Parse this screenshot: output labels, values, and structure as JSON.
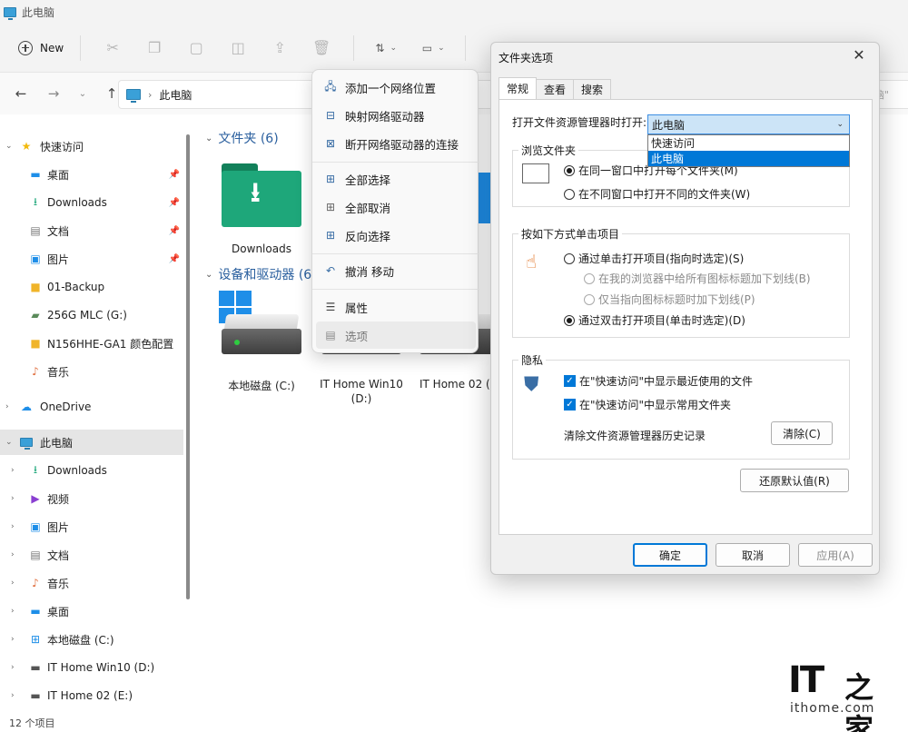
{
  "window": {
    "title": "此电脑"
  },
  "commandbar": {
    "new_label": "New"
  },
  "address": {
    "path": "此电脑",
    "right_fragment": "脑\""
  },
  "sidebar": {
    "quick_access": "快速访问",
    "quick_items": [
      {
        "label": "桌面",
        "pinned": true
      },
      {
        "label": "Downloads",
        "pinned": true
      },
      {
        "label": "文档",
        "pinned": true
      },
      {
        "label": "图片",
        "pinned": true
      },
      {
        "label": "01-Backup"
      },
      {
        "label": "256G MLC (G:)"
      },
      {
        "label": "N156HHE-GA1 颜色配置"
      },
      {
        "label": "音乐"
      }
    ],
    "onedrive": "OneDrive",
    "this_pc": "此电脑",
    "pc_items": [
      "Downloads",
      "视频",
      "图片",
      "文档",
      "音乐",
      "桌面",
      "本地磁盘 (C:)",
      "IT Home Win10 (D:)",
      "IT Home 02 (E:)"
    ]
  },
  "status": {
    "item_count": "12 个项目"
  },
  "content": {
    "folders_header": "文件夹 (6)",
    "downloads_tile": "Downloads",
    "devices_header": "设备和驱动器 (6",
    "drives": [
      "本地磁盘 (C:)",
      "IT Home Win10",
      "(D:)",
      "IT Home 02 (E"
    ]
  },
  "context_menu": {
    "items": [
      {
        "label": "添加一个网络位置",
        "icon": "network-location-icon"
      },
      {
        "label": "映射网络驱动器",
        "icon": "map-drive-icon"
      },
      {
        "label": "断开网络驱动器的连接",
        "icon": "disconnect-drive-icon"
      },
      {
        "label": "全部选择",
        "icon": "select-all-icon"
      },
      {
        "label": "全部取消",
        "icon": "select-none-icon"
      },
      {
        "label": "反向选择",
        "icon": "invert-selection-icon"
      },
      {
        "label": "撤消 移动",
        "icon": "undo-icon"
      },
      {
        "label": "属性",
        "icon": "properties-icon"
      },
      {
        "label": "选项",
        "icon": "options-icon"
      }
    ]
  },
  "dialog": {
    "title": "文件夹选项",
    "tabs": [
      "常规",
      "查看",
      "搜索"
    ],
    "open_label": "打开文件资源管理器时打开:",
    "open_value": "此电脑",
    "open_options": [
      "快速访问",
      "此电脑"
    ],
    "browse_legend": "浏览文件夹",
    "browse_same": "在同一窗口中打开每个文件夹(M)",
    "browse_diff": "在不同窗口中打开不同的文件夹(W)",
    "click_legend": "按如下方式单击项目",
    "single_click": "通过单击打开项目(指向时选定)(S)",
    "underline_all": "在我的浏览器中给所有图标标题加下划线(B)",
    "underline_hover": "仅当指向图标标题时加下划线(P)",
    "double_click": "通过双击打开项目(单击时选定)(D)",
    "privacy_legend": "隐私",
    "show_recent": "在\"快速访问\"中显示最近使用的文件",
    "show_frequent": "在\"快速访问\"中显示常用文件夹",
    "clear_history": "清除文件资源管理器历史记录",
    "clear_btn": "清除(C)",
    "restore_btn": "还原默认值(R)",
    "ok_btn": "确定",
    "cancel_btn": "取消",
    "apply_btn": "应用(A)"
  },
  "watermark": {
    "brand": "IT",
    "brand_cn": "之家",
    "url": "ithome.com"
  },
  "colors": {
    "accent": "#0078d7",
    "folder_green": "#1ea77a",
    "link_blue": "#2a5f9e"
  }
}
